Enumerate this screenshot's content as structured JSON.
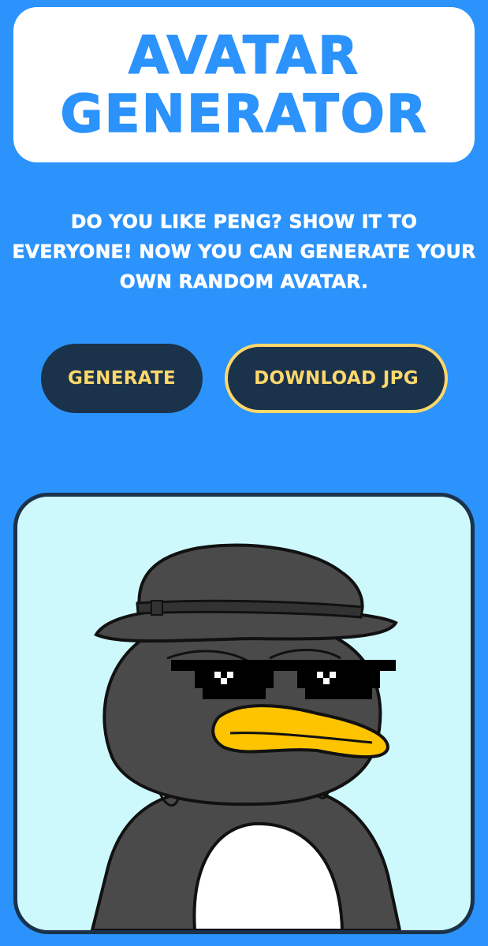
{
  "header": {
    "title_line1": "AVATAR",
    "title_line2": "GENERATOR"
  },
  "intro": {
    "line1": "DO YOU LIKE PENG? SHOW IT TO",
    "line2": "EVERYONE! NOW YOU CAN GENERATE YOUR",
    "line3": "OWN RANDOM AVATAR."
  },
  "actions": {
    "generate_label": "GENERATE",
    "download_label": "DOWNLOAD JPG"
  },
  "avatar": {
    "character": "penguin",
    "accessories": [
      "bucket-hat",
      "pixel-sunglasses"
    ]
  },
  "colors": {
    "background": "#2b93fb",
    "button_bg": "#1b324b",
    "button_text": "#ffd86b",
    "avatar_bg": "#cdf9fc"
  }
}
